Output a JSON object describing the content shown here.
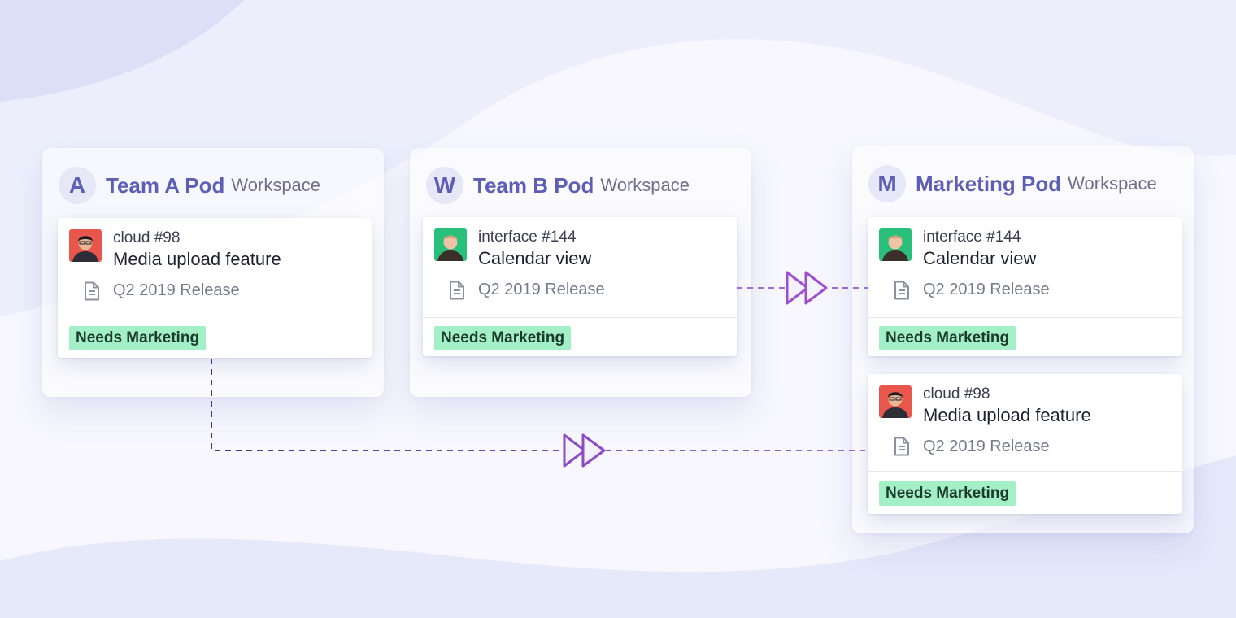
{
  "workspaces": [
    {
      "initial": "A",
      "name": "Team A Pod",
      "type": "Workspace"
    },
    {
      "initial": "W",
      "name": "Team B Pod",
      "type": "Workspace"
    },
    {
      "initial": "M",
      "name": "Marketing Pod",
      "type": "Workspace"
    }
  ],
  "cards": [
    {
      "ref": "cloud #98",
      "title": "Media upload feature",
      "release": "Q2 2019 Release",
      "label": "Needs Marketing",
      "avatar": "avatar-red",
      "icon": "document-icon"
    },
    {
      "ref": "interface #144",
      "title": "Calendar view",
      "release": "Q2 2019 Release",
      "label": "Needs Marketing",
      "avatar": "avatar-green",
      "icon": "document-icon"
    },
    {
      "ref": "interface #144",
      "title": "Calendar view",
      "release": "Q2 2019 Release",
      "label": "Needs Marketing",
      "avatar": "avatar-green",
      "icon": "document-icon"
    },
    {
      "ref": "cloud #98",
      "title": "Media upload feature",
      "release": "Q2 2019 Release",
      "label": "Needs Marketing",
      "avatar": "avatar-red",
      "icon": "document-icon"
    }
  ],
  "colors": {
    "accent": "#5d5fb6",
    "label_bg": "#a4f0c6",
    "connector_dark": "#3d3a8c",
    "connector_light": "#a06ad6"
  }
}
